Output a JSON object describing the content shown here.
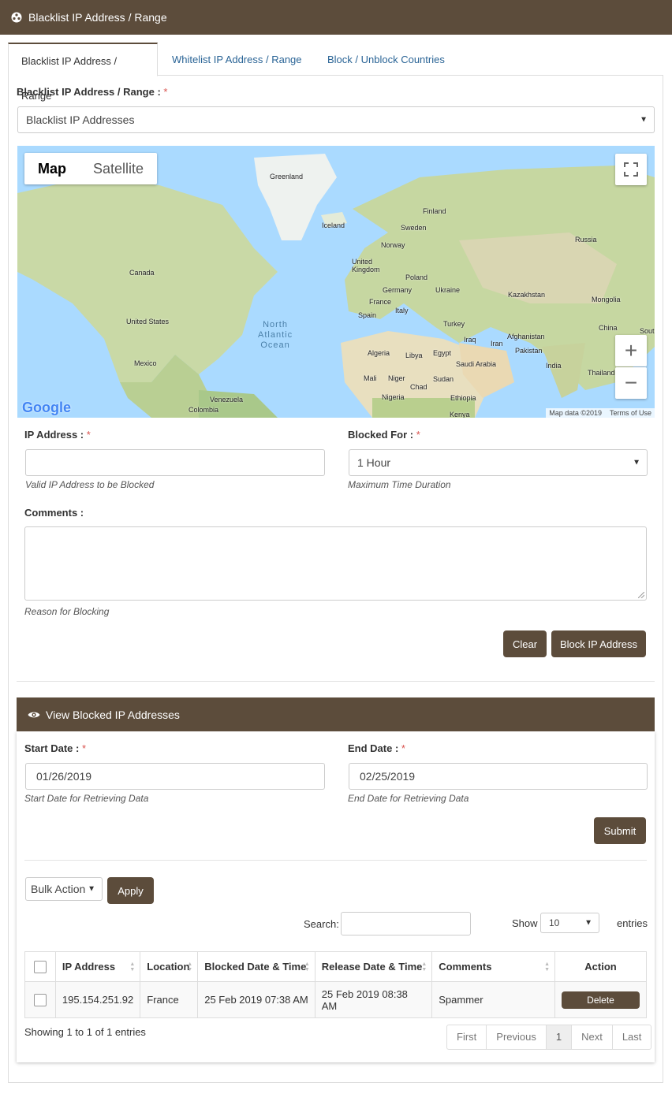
{
  "header": {
    "title": "Blacklist IP Address / Range"
  },
  "tabs": [
    {
      "label": "Blacklist IP Address / Range"
    },
    {
      "label": "Whitelist IP Address / Range"
    },
    {
      "label": "Block / Unblock Countries"
    }
  ],
  "mode": {
    "label": "Blacklist IP Address / Range :",
    "required": "*",
    "selected": "Blacklist IP Addresses"
  },
  "map": {
    "type_buttons": [
      "Map",
      "Satellite"
    ],
    "labels": {
      "greenland": "Greenland",
      "iceland": "Iceland",
      "finland": "Finland",
      "sweden": "Sweden",
      "norway": "Norway",
      "russia": "Russia",
      "uk": "United\nKingdom",
      "canada": "Canada",
      "poland": "Poland",
      "germany": "Germany",
      "ukraine": "Ukraine",
      "kazakhstan": "Kazakhstan",
      "mongolia": "Mongolia",
      "france": "France",
      "spain": "Spain",
      "italy": "Italy",
      "turkey": "Turkey",
      "china": "China",
      "south": "Sout",
      "us": "United States",
      "ocean": "North\nAtlantic\nOcean",
      "iraq": "Iraq",
      "iran": "Iran",
      "afghanistan": "Afghanistan",
      "pakistan": "Pakistan",
      "algeria": "Algeria",
      "libya": "Libya",
      "egypt": "Egypt",
      "saudi": "Saudi Arabia",
      "india": "India",
      "mexico": "Mexico",
      "thailand": "Thailand",
      "mali": "Mali",
      "niger": "Niger",
      "chad": "Chad",
      "sudan": "Sudan",
      "nigeria": "Nigeria",
      "ethiopia": "Ethiopia",
      "venezuela": "Venezuela",
      "colombia": "Colombia",
      "kenya": "Kenya"
    },
    "logo": "Google",
    "attribution": "Map data ©2019",
    "terms": "Terms of Use"
  },
  "form": {
    "ip_label": "IP Address :",
    "ip_value": "",
    "ip_help": "Valid IP Address to be Blocked",
    "blocked_for_label": "Blocked For :",
    "blocked_for_value": "1 Hour",
    "blocked_for_help": "Maximum Time Duration",
    "comments_label": "Comments :",
    "comments_help": "Reason for Blocking",
    "clear_button": "Clear",
    "block_button": "Block IP Address"
  },
  "view": {
    "title": "View Blocked IP Addresses",
    "start_label": "Start Date :",
    "start_value": "01/26/2019",
    "start_help": "Start Date for Retrieving Data",
    "end_label": "End Date :",
    "end_value": "02/25/2019",
    "end_help": "End Date for Retrieving Data",
    "submit_button": "Submit",
    "bulk_action": "Bulk Action",
    "apply_button": "Apply",
    "search_label": "Search:",
    "show_label": "Show",
    "show_value": "10",
    "entries_label": "entries",
    "columns": [
      "IP Address",
      "Location",
      "Blocked Date & Time",
      "Release Date & Time",
      "Comments",
      "Action"
    ],
    "rows": [
      {
        "ip": "195.154.251.92",
        "location": "France",
        "blocked": "25 Feb 2019 07:38 AM",
        "release": "25 Feb 2019 08:38 AM",
        "comments": "Spammer",
        "action": "Delete"
      }
    ],
    "showing": "Showing 1 to 1 of 1 entries",
    "pager": [
      "First",
      "Previous",
      "1",
      "Next",
      "Last"
    ]
  }
}
